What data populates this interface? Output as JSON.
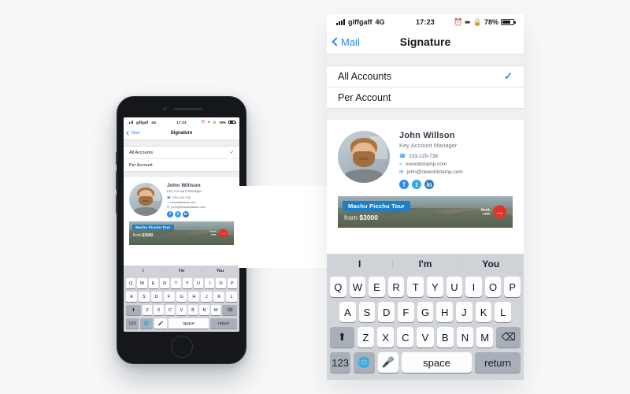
{
  "status_bar": {
    "carrier": "giffgaff",
    "network": "4G",
    "time": "17:23",
    "battery_percent": "78%",
    "battery_level": 78,
    "icons": [
      "signal-bars-icon",
      "alarm-icon",
      "location-icon",
      "rotation-lock-icon",
      "battery-icon"
    ]
  },
  "nav": {
    "back_label": "Mail",
    "title": "Signature"
  },
  "account_list": {
    "items": [
      {
        "label": "All Accounts",
        "selected": true,
        "check": "✓"
      },
      {
        "label": "Per Account",
        "selected": false,
        "check": ""
      }
    ]
  },
  "signature": {
    "name": "John Willson",
    "role": "Key Account Manager",
    "contact": [
      {
        "icon": "phone-icon",
        "glyph": "☎",
        "text": "233-129-738"
      },
      {
        "icon": "globe-icon",
        "glyph": "⌁",
        "text": "newoldstamp.com"
      },
      {
        "icon": "envelope-icon",
        "glyph": "✉",
        "text": "john@newoldstamp.com"
      }
    ],
    "socials": [
      {
        "name": "facebook-icon",
        "glyph": "f"
      },
      {
        "name": "twitter-icon",
        "glyph": "t"
      },
      {
        "name": "linkedin-icon",
        "glyph": "in"
      }
    ],
    "banner": {
      "title": "Machu Picchu Tour",
      "price_prefix": "from",
      "price": "$3000",
      "cta_line1": "Book",
      "cta_line2": "now",
      "arrow": "→",
      "tag_color": "#1f7ec4",
      "arrow_color": "#e0352b"
    }
  },
  "keyboard": {
    "predictions": [
      "I",
      "I'm",
      "You"
    ],
    "row1": [
      "Q",
      "W",
      "E",
      "R",
      "T",
      "Y",
      "U",
      "I",
      "O",
      "P"
    ],
    "row2": [
      "A",
      "S",
      "D",
      "F",
      "G",
      "H",
      "J",
      "K",
      "L"
    ],
    "row3": [
      "Z",
      "X",
      "C",
      "V",
      "B",
      "N",
      "M"
    ],
    "shift": "⬆",
    "delete": "⌫",
    "numbers": "123",
    "globe": "ἱ0",
    "mic": "Ἲ4",
    "space": "space",
    "return": "return"
  },
  "colors": {
    "accent": "#2b8cf0",
    "keyboard_bg": "#d1d4d9",
    "page_bg": "#f7f8f9"
  }
}
